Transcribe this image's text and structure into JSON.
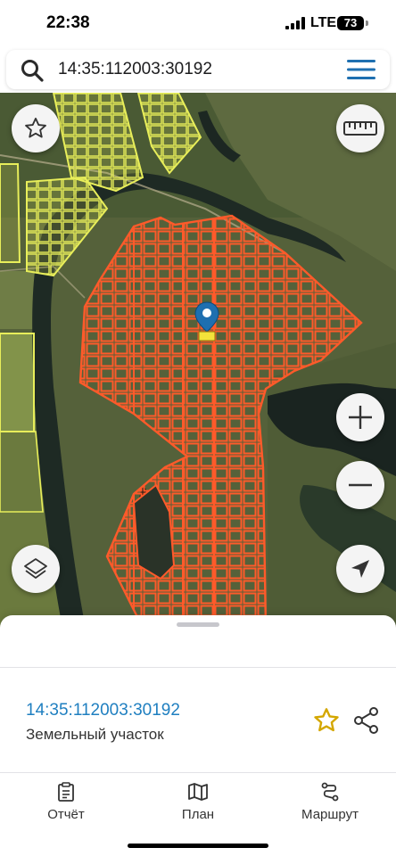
{
  "status_bar": {
    "time": "22:38",
    "network": "LTE",
    "battery": "73"
  },
  "search": {
    "value": "14:35:112003:30192",
    "icon": "search-icon",
    "menu_icon": "menu-icon"
  },
  "map": {
    "pin_icon": "location-pin-icon",
    "controls": {
      "favorite": "star-icon",
      "ruler": "ruler-icon",
      "zoom_in": "plus-icon",
      "zoom_out": "minus-icon",
      "layers": "layers-icon",
      "locate": "navigation-arrow-icon"
    },
    "colors": {
      "parcel_highlight": "#ff5a2a",
      "neighbor_parcels": "#e8ee5a",
      "pin": "#1e6fb0"
    }
  },
  "sheet": {
    "cadastral_number": "14:35:112003:30192",
    "parcel_type": "Земельный участок",
    "favorite_icon": "star-outline-icon",
    "share_icon": "share-icon",
    "accent_color": "#1f7fc0",
    "star_color": "#d4a700"
  },
  "tabs": [
    {
      "label": "Отчёт",
      "icon": "report-icon"
    },
    {
      "label": "План",
      "icon": "map-plan-icon"
    },
    {
      "label": "Маршрут",
      "icon": "route-icon"
    }
  ]
}
